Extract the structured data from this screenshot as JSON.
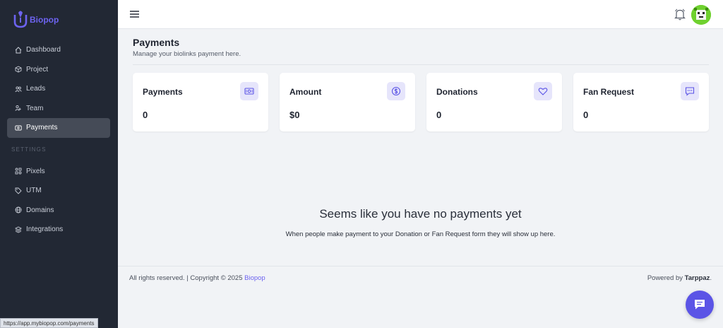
{
  "brand": {
    "name": "Biopop",
    "accent": "#6d63f0"
  },
  "sidebar": {
    "items": [
      {
        "label": "Dashboard",
        "icon": "home-icon"
      },
      {
        "label": "Project",
        "icon": "box-icon"
      },
      {
        "label": "Leads",
        "icon": "users-icon"
      },
      {
        "label": "Team",
        "icon": "team-icon"
      },
      {
        "label": "Payments",
        "icon": "payments-icon",
        "active": true
      }
    ],
    "settings_heading": "SETTINGS",
    "settings_items": [
      {
        "label": "Pixels",
        "icon": "pixels-icon"
      },
      {
        "label": "UTM",
        "icon": "tag-icon"
      },
      {
        "label": "Domains",
        "icon": "globe-icon"
      },
      {
        "label": "Integrations",
        "icon": "layers-icon"
      }
    ]
  },
  "header": {
    "title": "Payments",
    "subtitle": "Manage your biolinks payment here."
  },
  "cards": [
    {
      "label": "Payments",
      "value": "0",
      "icon": "banknote-icon"
    },
    {
      "label": "Amount",
      "value": "$0",
      "icon": "dollar-circle-icon"
    },
    {
      "label": "Donations",
      "value": "0",
      "icon": "heart-icon"
    },
    {
      "label": "Fan Request",
      "value": "0",
      "icon": "message-icon"
    }
  ],
  "empty_state": {
    "title": "Seems like you have no payments yet",
    "message": "When people make payment to your Donation or Fan Request form they will show up here."
  },
  "footer": {
    "rights": "All rights reserved. | Copyright © 2025 ",
    "brand_link": "Biopop",
    "powered_by": "Powered by ",
    "powered_name": "Tarppaz",
    "powered_suffix": "."
  },
  "status_url": "https://app.mybiopop.com/payments"
}
